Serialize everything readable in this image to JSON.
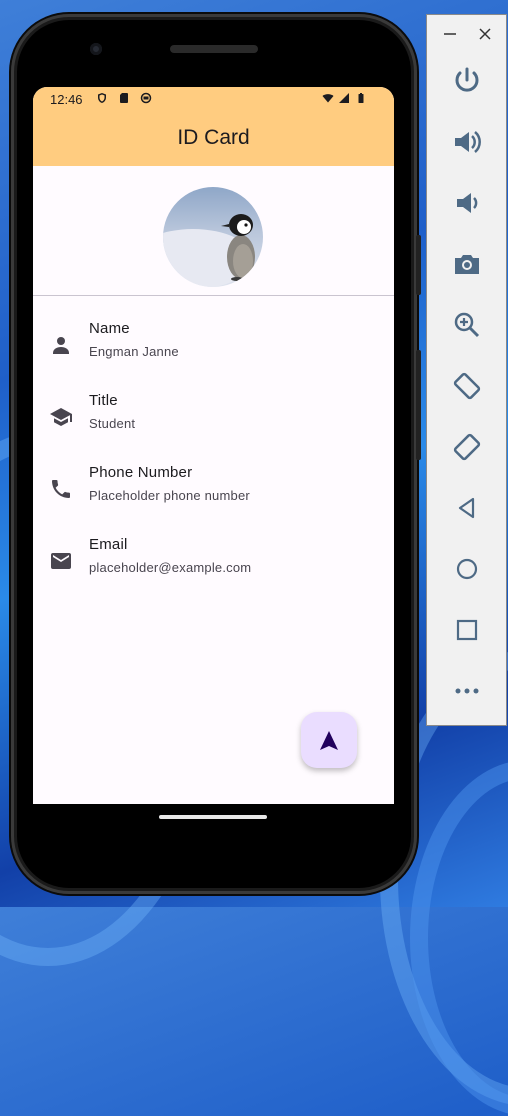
{
  "status_bar": {
    "time": "12:46"
  },
  "app": {
    "title": "ID Card"
  },
  "profile": {
    "items": [
      {
        "icon": "person-icon",
        "label": "Name",
        "value": "Engman Janne"
      },
      {
        "icon": "school-icon",
        "label": "Title",
        "value": "Student"
      },
      {
        "icon": "phone-icon",
        "label": "Phone Number",
        "value": "Placeholder phone number"
      },
      {
        "icon": "email-icon",
        "label": "Email",
        "value": "placeholder@example.com"
      }
    ]
  },
  "fab": {
    "icon": "navigation-icon"
  },
  "emulator_panel": {
    "buttons": [
      "power-icon",
      "volume-up-icon",
      "volume-down-icon",
      "camera-icon",
      "zoom-in-icon",
      "rotate-left-icon",
      "rotate-right-icon",
      "back-icon",
      "home-icon",
      "overview-icon",
      "more-icon"
    ]
  },
  "colors": {
    "appbar": "#ffcc80",
    "fab": "#eaddff",
    "fab_icon": "#21005d",
    "icon": "#49454f"
  }
}
